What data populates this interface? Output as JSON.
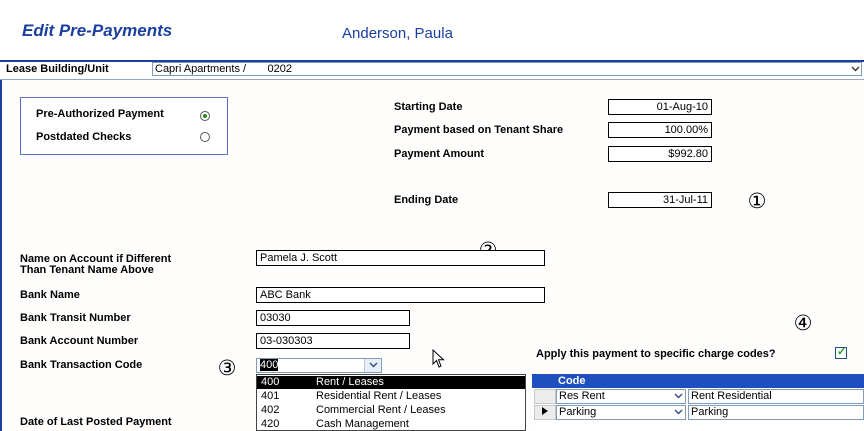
{
  "header": {
    "title": "Edit Pre-Payments",
    "tenant_name": "Anderson, Paula"
  },
  "lease": {
    "label": "Lease Building/Unit",
    "value": "Capri Apartments /       0202",
    "dropdown_icon": "chevron-down-icon"
  },
  "payment_type": {
    "options": [
      {
        "label": "Pre-Authorized Payment",
        "selected": true
      },
      {
        "label": "Postdated Checks",
        "selected": false
      }
    ]
  },
  "schedule": {
    "starting_date_label": "Starting Date",
    "starting_date": "01-Aug-10",
    "tenant_share_label": "Payment based on Tenant Share",
    "tenant_share": "100.00%",
    "payment_amount_label": "Payment Amount",
    "payment_amount": "$992.80",
    "ending_date_label": "Ending Date",
    "ending_date": "31-Jul-11"
  },
  "bank": {
    "name_on_account_label_line1": "Name on Account if Different",
    "name_on_account_label_line2": "Than Tenant Name Above",
    "name_on_account": "Pamela J. Scott",
    "bank_name_label": "Bank Name",
    "bank_name": "ABC Bank",
    "transit_label": "Bank Transit Number",
    "transit": "03030",
    "account_label": "Bank Account Number",
    "account": "03-030303",
    "transaction_code_label": "Bank Transaction Code",
    "transaction_code": "400",
    "last_posted_label": "Date of Last Posted Payment"
  },
  "transaction_code_options": [
    {
      "code": "400",
      "desc": "Rent / Leases"
    },
    {
      "code": "401",
      "desc": "Residential Rent / Leases"
    },
    {
      "code": "402",
      "desc": "Commercial Rent / Leases"
    },
    {
      "code": "420",
      "desc": "Cash Management"
    }
  ],
  "charge_codes": {
    "apply_label": "Apply this payment to specific charge codes?",
    "apply_checked": true,
    "column_header": "Code",
    "rows": [
      {
        "code": "Res Rent",
        "desc": "Rent Residential",
        "current": false
      },
      {
        "code": "Parking",
        "desc": "Parking",
        "current": true
      }
    ]
  },
  "callouts": [
    "①",
    "②",
    "③",
    "④"
  ],
  "colors": {
    "title_blue": "#1a3fa0",
    "grid_header": "#1f4fbf",
    "radio_selected": "#1f8a1f"
  }
}
